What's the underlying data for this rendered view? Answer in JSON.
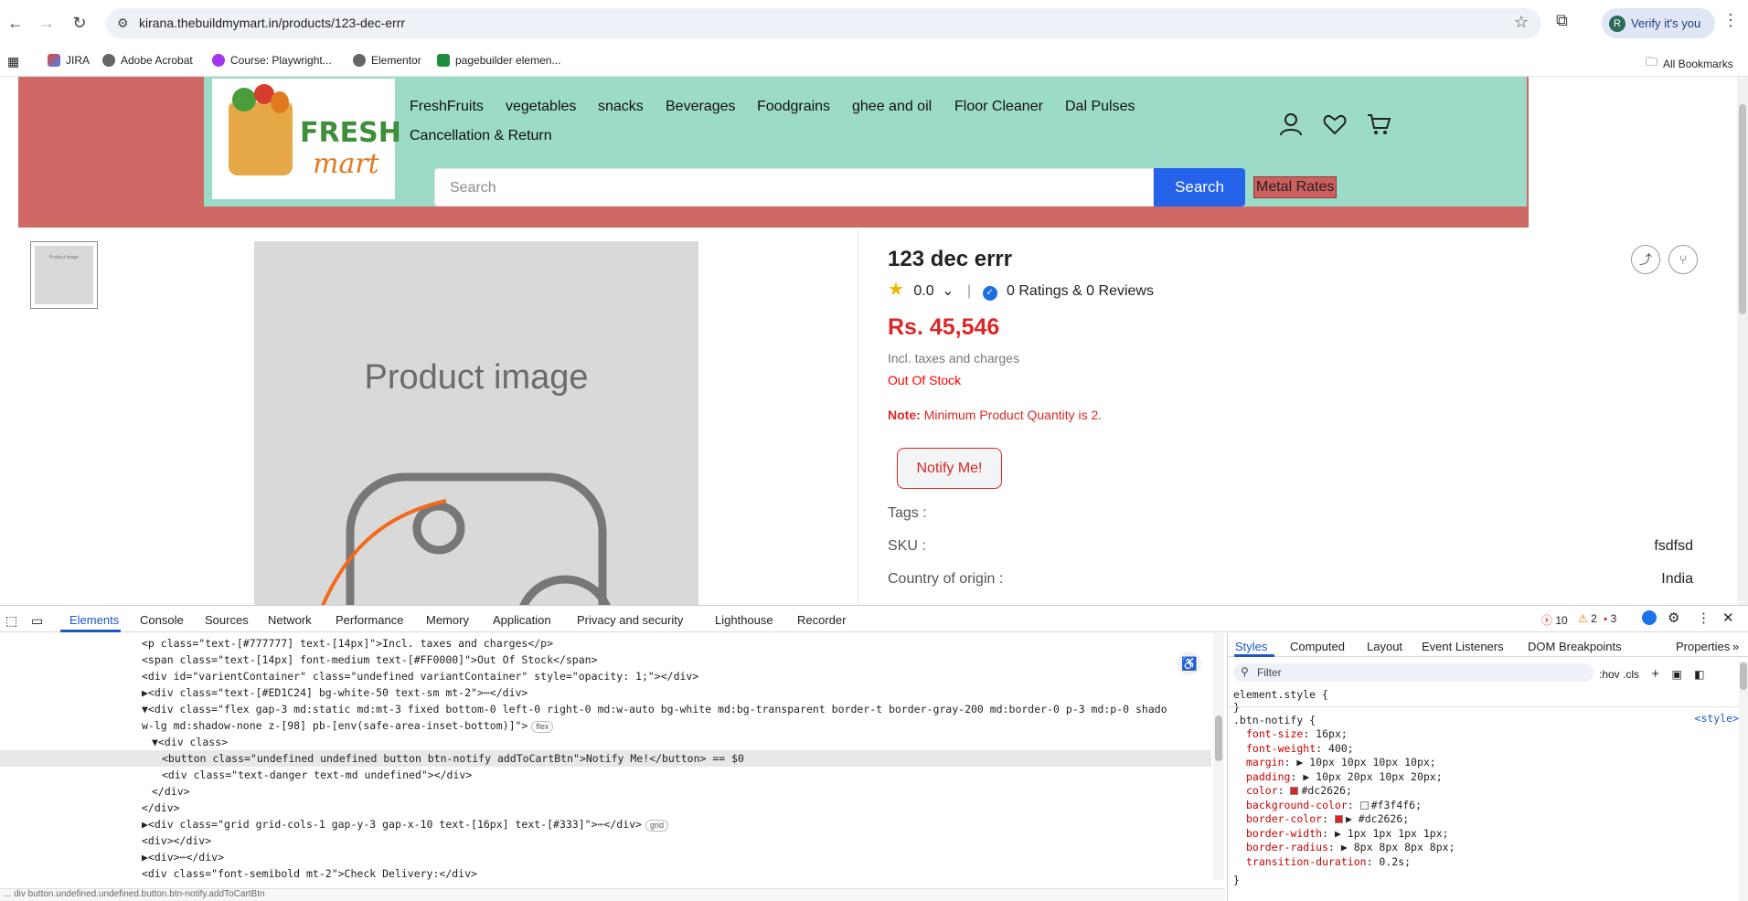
{
  "browser": {
    "url": "kirana.thebuildmymart.in/products/123-dec-errr",
    "verify_label": "Verify it's you",
    "avatar_letter": "R",
    "bookmarks": [
      "JIRA",
      "Adobe Acrobat",
      "Course: Playwright...",
      "Elementor",
      "pagebuilder elemen..."
    ],
    "all_bookmarks": "All Bookmarks"
  },
  "site": {
    "logo_word1": "FRESH",
    "logo_word2": "mart",
    "nav": [
      "FreshFruits",
      "vegetables",
      "snacks",
      "Beverages",
      "Foodgrains",
      "ghee and oil",
      "Floor Cleaner",
      "Dal Pulses",
      "Cancellation & Return"
    ],
    "search_placeholder": "Search",
    "search_button": "Search",
    "metal_rates": "Metal Rates"
  },
  "product": {
    "thumb_label": "Product image",
    "image_label": "Product image",
    "title": "123 dec errr",
    "rating": "0.0",
    "reviews": "0 Ratings & 0 Reviews",
    "price": "Rs. 45,546",
    "tax_note": "Incl. taxes and charges",
    "stock": "Out Of Stock",
    "note_label": "Note:",
    "note_text": "Minimum Product Quantity is 2.",
    "notify_button": "Notify Me!",
    "specs": [
      {
        "label": "Tags :",
        "value": ""
      },
      {
        "label": "SKU :",
        "value": "fsdfsd"
      },
      {
        "label": "Country of origin :",
        "value": "India"
      }
    ]
  },
  "devtools": {
    "tabs": [
      "Elements",
      "Console",
      "Sources",
      "Network",
      "Performance",
      "Memory",
      "Application",
      "Privacy and security",
      "Lighthouse",
      "Recorder"
    ],
    "errors": "10",
    "warnings": "2",
    "issues": "3",
    "dom_lines": [
      {
        "indent": 0,
        "text": "<p class=\"text-[#777777] text-[14px]\">Incl. taxes and charges</p>"
      },
      {
        "indent": 0,
        "text": "<span class=\"text-[14px] font-medium text-[#FF0000]\">Out Of Stock</span>"
      },
      {
        "indent": 0,
        "text": "<div id=\"varientContainer\" class=\"undefined  variantContainer\" style=\"opacity: 1;\"></div>"
      },
      {
        "indent": 0,
        "text": "▶<div class=\"text-[#ED1C24] bg-white-50   text-sm mt-2\">⋯</div>"
      },
      {
        "indent": 0,
        "text": "▼<div class=\"flex gap-3 md:static md:mt-3 fixed bottom-0 left-0 right-0 md:w-auto bg-white md:bg-transparent border-t border-gray-200 md:border-0 p-3 md:p-0 shado"
      },
      {
        "indent": 0,
        "text": "w-lg md:shadow-none z-[98] pb-[env(safe-area-inset-bottom)]\">"
      },
      {
        "indent": 1,
        "text": "▼<div class>"
      },
      {
        "indent": 2,
        "text": "<button class=\"undefined undefined button btn-notify addToCartBtn\">Notify Me!</button> == $0"
      },
      {
        "indent": 2,
        "text": "<div class=\"text-danger text-md undefined\"></div>"
      },
      {
        "indent": 1,
        "text": "</div>"
      },
      {
        "indent": 0,
        "text": "</div>"
      },
      {
        "indent": 0,
        "text": "▶<div class=\"grid grid-cols-1  gap-y-3 gap-x-10 text-[16px] text-[#333]\">⋯</div>"
      },
      {
        "indent": 0,
        "text": "<div></div>"
      },
      {
        "indent": 0,
        "text": "▶<div>⋯</div>"
      },
      {
        "indent": 0,
        "text": "<div class=\"font-semibold mt-2\">Check Delivery:</div>"
      }
    ],
    "flex_badge": "flex",
    "grid_badge": "grid",
    "breadcrumb": "...  div  button.undefined.undefined.button.btn-notify.addToCartBtn",
    "style_tabs": [
      "Styles",
      "Computed",
      "Layout",
      "Event Listeners",
      "DOM Breakpoints",
      "Properties"
    ],
    "filter_placeholder": "Filter",
    "filter_opts": ":hov  .cls",
    "element_style": "element.style {",
    "close_brace": "}",
    "rule_selector": ".btn-notify {",
    "rule_source": "<style>",
    "rules": [
      {
        "prop": "font-size",
        "val": "16px;"
      },
      {
        "prop": "font-weight",
        "val": "400;"
      },
      {
        "prop": "margin",
        "val": "▶ 10px 10px 10px 10px;"
      },
      {
        "prop": "padding",
        "val": "▶ 10px 20px 10px 20px;"
      },
      {
        "prop": "color",
        "val": "#dc2626;",
        "swatch": "#dc2626"
      },
      {
        "prop": "background-color",
        "val": "#f3f4f6;",
        "swatch": "#f3f4f6"
      },
      {
        "prop": "border-color",
        "val": "▶ #dc2626;",
        "swatch": "#dc2626"
      },
      {
        "prop": "border-width",
        "val": "▶ 1px 1px 1px 1px;"
      },
      {
        "prop": "border-radius",
        "val": "▶ 8px 8px 8px 8px;"
      },
      {
        "prop": "transition-duration",
        "val": "0.2s;"
      }
    ]
  }
}
